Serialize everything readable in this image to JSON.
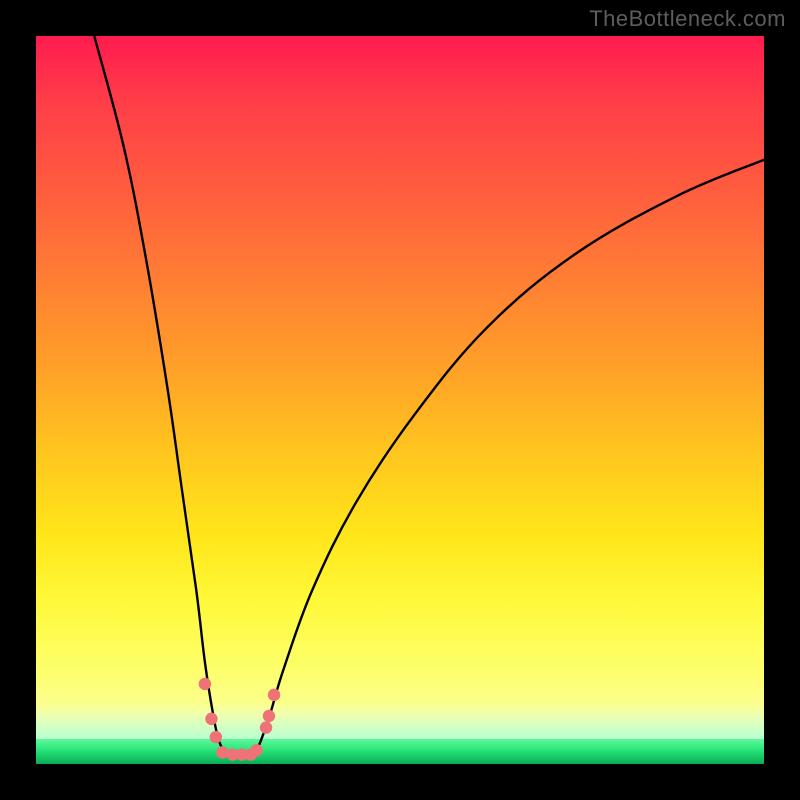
{
  "watermark": "TheBottleneck.com",
  "colors": {
    "frame_border": "#000000",
    "gradient_top": "#ff1b4f",
    "gradient_mid": "#ffe61a",
    "gradient_green": "#1fd971",
    "curve_stroke": "#000000",
    "marker_fill": "#ef7376"
  },
  "chart_data": {
    "type": "line",
    "title": "",
    "xlabel": "",
    "ylabel": "",
    "xlim": [
      0,
      100
    ],
    "ylim": [
      0,
      100
    ],
    "note": "Two steep curves descend from high y on either side toward a narrow minimum near x≈26, forming a V shape; background heat gradient goes red→yellow→green (bottleneck severity). Small salmon markers cluster near the valley bottom.",
    "series": [
      {
        "name": "left-curve",
        "xy": [
          [
            8,
            100
          ],
          [
            12,
            85
          ],
          [
            15,
            70
          ],
          [
            18,
            52
          ],
          [
            20,
            38
          ],
          [
            22,
            24
          ],
          [
            23.2,
            14
          ],
          [
            24.3,
            7
          ],
          [
            25.2,
            3
          ],
          [
            26.5,
            1.2
          ],
          [
            28.5,
            1.2
          ]
        ]
      },
      {
        "name": "right-curve",
        "xy": [
          [
            28.5,
            1.2
          ],
          [
            29.8,
            1.2
          ],
          [
            30.8,
            3
          ],
          [
            32.2,
            7
          ],
          [
            34.0,
            13
          ],
          [
            38,
            24
          ],
          [
            44,
            36
          ],
          [
            52,
            48
          ],
          [
            62,
            60
          ],
          [
            74,
            70
          ],
          [
            88,
            78
          ],
          [
            100,
            83
          ]
        ]
      }
    ],
    "markers": [
      {
        "x": 23.2,
        "y": 11.0
      },
      {
        "x": 24.1,
        "y": 6.2
      },
      {
        "x": 24.7,
        "y": 3.7
      },
      {
        "x": 25.6,
        "y": 1.6
      },
      {
        "x": 27.0,
        "y": 1.3
      },
      {
        "x": 28.3,
        "y": 1.3
      },
      {
        "x": 29.5,
        "y": 1.3
      },
      {
        "x": 30.3,
        "y": 1.9
      },
      {
        "x": 31.6,
        "y": 5.0
      },
      {
        "x": 32.0,
        "y": 6.6
      },
      {
        "x": 32.7,
        "y": 9.5
      }
    ]
  }
}
